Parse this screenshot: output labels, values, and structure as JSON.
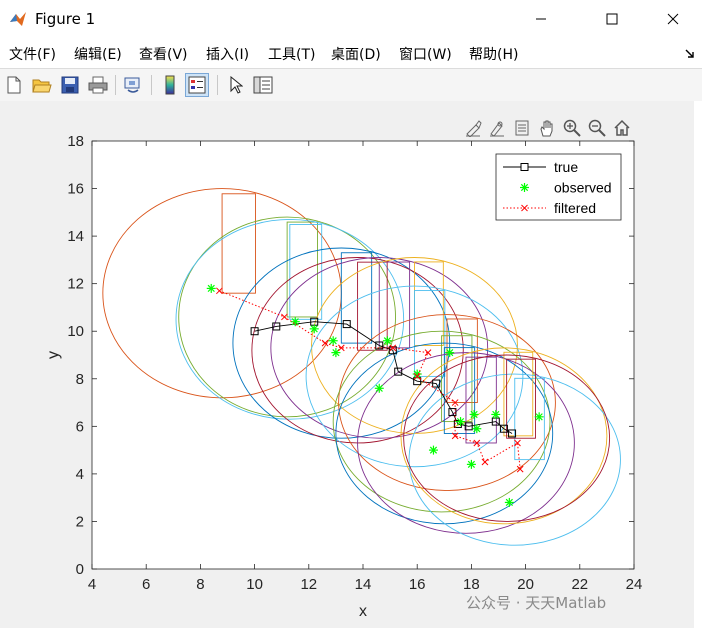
{
  "window": {
    "title": "Figure 1",
    "minimize_icon": "minimize-icon",
    "maximize_icon": "maximize-icon",
    "close_icon": "close-icon"
  },
  "menu": {
    "items": [
      "文件(F)",
      "编辑(E)",
      "查看(V)",
      "插入(I)",
      "工具(T)",
      "桌面(D)",
      "窗口(W)",
      "帮助(H)"
    ],
    "overflow_icon": "dock-arrow-icon"
  },
  "toolbar": {
    "buttons": [
      "new-figure-icon",
      "open-file-icon",
      "save-icon",
      "print-icon",
      "link-plot-icon",
      "colorbar-icon",
      "legend-icon",
      "pointer-icon",
      "property-inspector-icon"
    ]
  },
  "axes_toolbar": {
    "buttons": [
      "brush-icon",
      "data-tips-icon",
      "export-icon",
      "pan-icon",
      "zoom-in-icon",
      "zoom-out-icon",
      "home-icon"
    ]
  },
  "watermark": "公众号 · 天天Matlab",
  "chart_data": {
    "type": "line",
    "xlabel": "x",
    "ylabel": "y",
    "xlim": [
      4,
      24
    ],
    "ylim": [
      0,
      18
    ],
    "xticks": [
      4,
      6,
      8,
      10,
      12,
      14,
      16,
      18,
      20,
      22,
      24
    ],
    "yticks": [
      0,
      2,
      4,
      6,
      8,
      10,
      12,
      14,
      16,
      18
    ],
    "grid": false,
    "legend_position": "top-right",
    "legend": [
      "true",
      "observed",
      "filtered"
    ],
    "series": [
      {
        "name": "true",
        "color": "#000000",
        "marker": "square",
        "linestyle": "solid",
        "x": [
          10.0,
          10.8,
          12.2,
          13.4,
          14.6,
          15.1,
          15.3,
          16.0,
          16.7,
          17.3,
          17.5,
          17.9,
          18.9,
          19.2,
          19.5
        ],
        "y": [
          10.0,
          10.2,
          10.4,
          10.3,
          9.4,
          9.2,
          8.3,
          7.9,
          7.8,
          6.6,
          6.1,
          6.0,
          6.2,
          5.9,
          5.7
        ]
      },
      {
        "name": "observed",
        "color": "#00ff00",
        "marker": "star",
        "linestyle": "none",
        "x": [
          8.4,
          11.5,
          12.2,
          12.9,
          13.0,
          14.6,
          14.9,
          16.0,
          16.6,
          17.2,
          17.6,
          18.1,
          18.2,
          18.0,
          18.9,
          19.4,
          20.5
        ],
        "y": [
          11.8,
          10.4,
          10.1,
          9.6,
          9.1,
          7.6,
          9.6,
          8.2,
          5.0,
          9.1,
          6.2,
          6.5,
          5.9,
          4.4,
          6.5,
          2.8,
          6.4
        ]
      },
      {
        "name": "filtered",
        "color": "#ff0000",
        "marker": "x",
        "linestyle": "dotted",
        "x": [
          8.7,
          11.1,
          12.6,
          13.2,
          15.1,
          16.4,
          16.0,
          17.4,
          17.4,
          18.2,
          18.5,
          19.7,
          19.8
        ],
        "y": [
          11.7,
          10.6,
          9.5,
          9.3,
          9.3,
          9.1,
          8.1,
          7.0,
          5.6,
          5.3,
          4.5,
          5.3,
          4.2
        ]
      }
    ],
    "covariance_ellipses": [
      {
        "cx": 8.8,
        "cy": 11.6,
        "rx": 4.4,
        "ry": 4.4,
        "color": "#d95319"
      },
      {
        "cx": 11.2,
        "cy": 10.6,
        "rx": 4.0,
        "ry": 4.2,
        "color": "#77ac30"
      },
      {
        "cx": 11.3,
        "cy": 10.5,
        "rx": 4.2,
        "ry": 4.2,
        "color": "#4dbeee"
      },
      {
        "cx": 13.2,
        "cy": 9.5,
        "rx": 4.0,
        "ry": 4.0,
        "color": "#0072bd"
      },
      {
        "cx": 13.8,
        "cy": 9.2,
        "rx": 3.9,
        "ry": 3.9,
        "color": "#a2142f"
      },
      {
        "cx": 14.6,
        "cy": 9.3,
        "rx": 4.0,
        "ry": 3.8,
        "color": "#7e2f8e"
      },
      {
        "cx": 15.9,
        "cy": 9.4,
        "rx": 3.8,
        "ry": 3.7,
        "color": "#edb120"
      },
      {
        "cx": 15.9,
        "cy": 8.1,
        "rx": 4.0,
        "ry": 3.8,
        "color": "#4dbeee"
      },
      {
        "cx": 17.1,
        "cy": 7.0,
        "rx": 4.0,
        "ry": 3.7,
        "color": "#d95319"
      },
      {
        "cx": 16.9,
        "cy": 6.2,
        "rx": 4.0,
        "ry": 3.8,
        "color": "#77ac30"
      },
      {
        "cx": 17.0,
        "cy": 5.7,
        "rx": 4.0,
        "ry": 3.8,
        "color": "#0072bd"
      },
      {
        "cx": 17.8,
        "cy": 5.3,
        "rx": 4.0,
        "ry": 3.8,
        "color": "#7e2f8e"
      },
      {
        "cx": 19.2,
        "cy": 5.6,
        "rx": 3.8,
        "ry": 3.7,
        "color": "#edb120"
      },
      {
        "cx": 19.6,
        "cy": 4.6,
        "rx": 3.9,
        "ry": 3.6,
        "color": "#4dbeee"
      },
      {
        "cx": 19.3,
        "cy": 5.5,
        "rx": 3.8,
        "ry": 3.5,
        "color": "#a2142f"
      }
    ]
  }
}
